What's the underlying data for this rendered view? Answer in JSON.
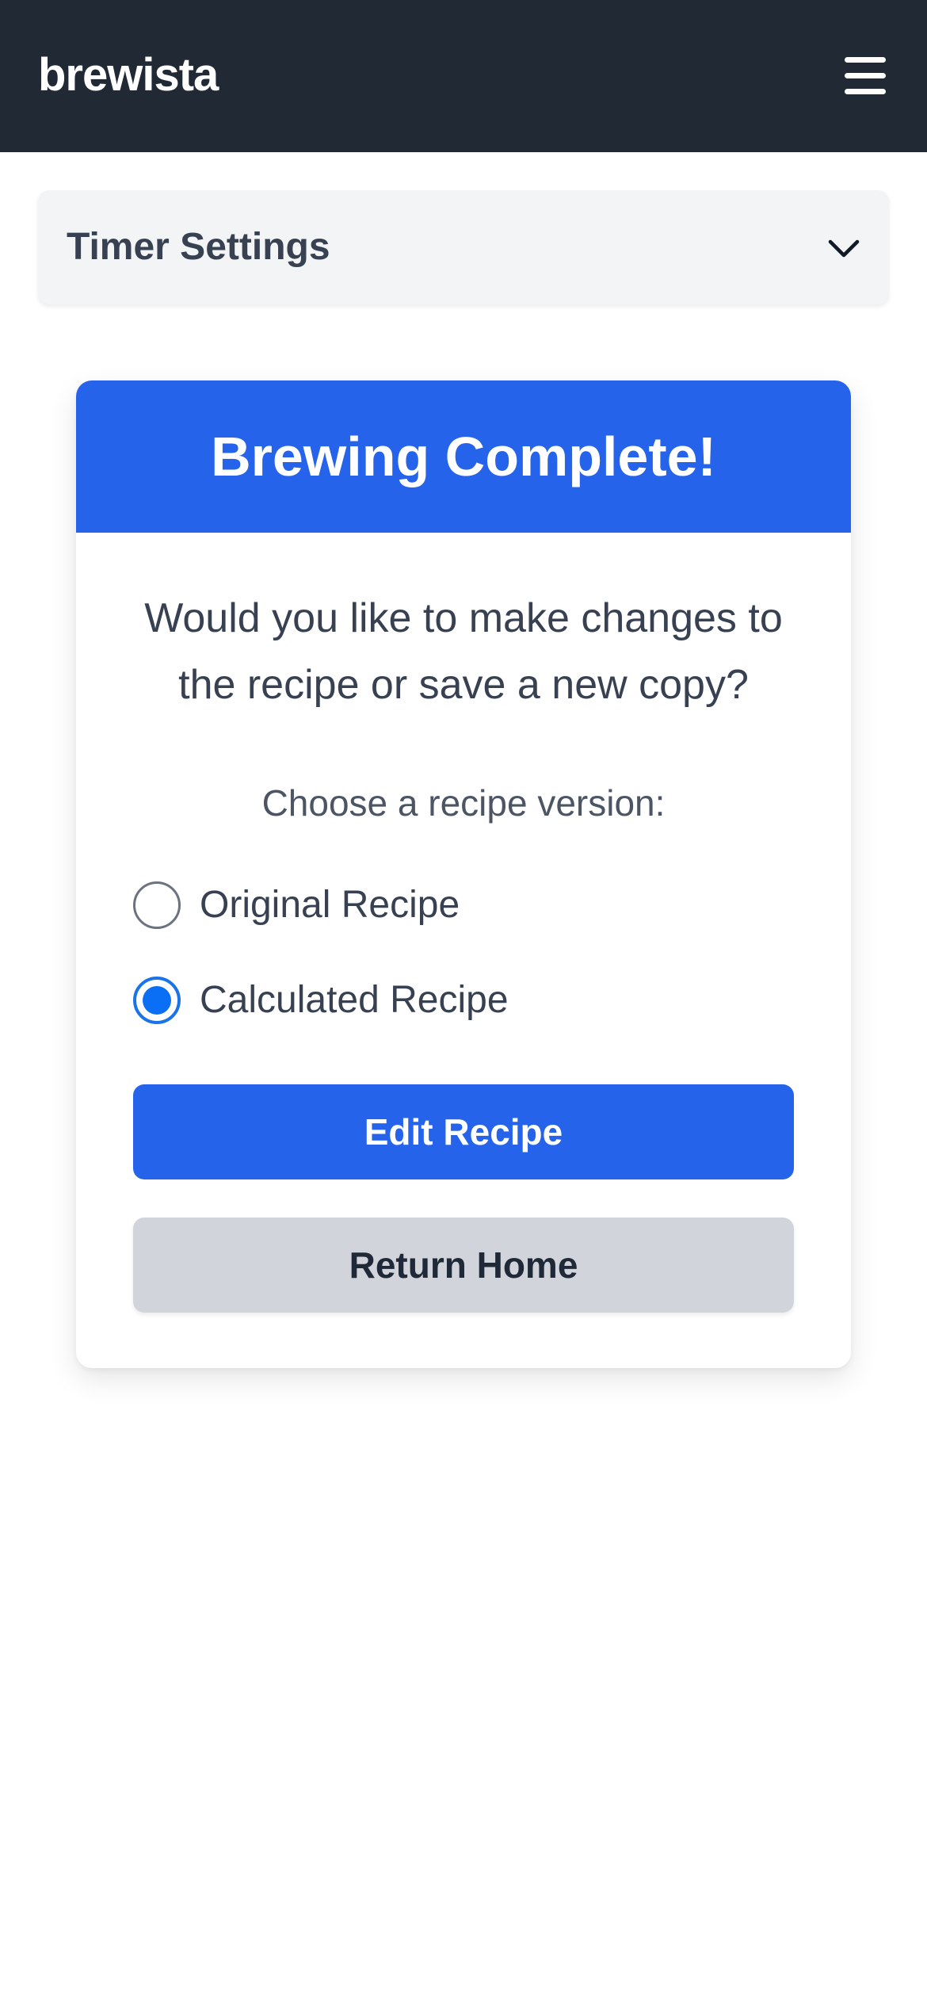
{
  "app": {
    "brand": "brewista",
    "menu_icon": "hamburger-menu-icon"
  },
  "timer_settings": {
    "label": "Timer Settings",
    "icon": "chevron-down-icon",
    "expanded": false
  },
  "completion_card": {
    "title": "Brewing Complete!",
    "question": "Would you like to make changes to the recipe or save a new copy?",
    "choose_label": "Choose a recipe version:",
    "options": [
      {
        "label": "Original Recipe",
        "selected": false
      },
      {
        "label": "Calculated Recipe",
        "selected": true
      }
    ],
    "primary_button": "Edit Recipe",
    "secondary_button": "Return Home"
  },
  "colors": {
    "navbar": "#212935",
    "accent": "#2563eb",
    "radio_selected": "#0b6ff5",
    "secondary_button": "#d1d5db",
    "panel": "#f3f4f6"
  }
}
